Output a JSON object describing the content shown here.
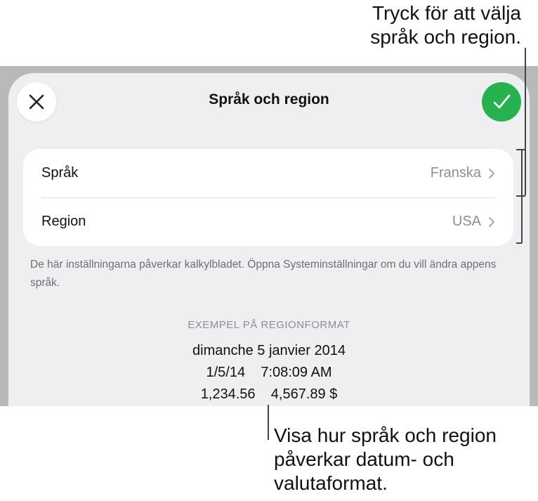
{
  "callouts": {
    "top_line1": "Tryck för att välja",
    "top_line2": "språk och region.",
    "bottom_line1": "Visa hur språk och region",
    "bottom_line2": "påverkar datum- och",
    "bottom_line3": "valutaformat."
  },
  "dialog": {
    "title": "Språk och region",
    "close_icon": "close-icon",
    "confirm_icon": "checkmark-icon"
  },
  "settings": {
    "language_label": "Språk",
    "language_value": "Franska",
    "region_label": "Region",
    "region_value": "USA"
  },
  "note": "De här inställningarna påverkar kalkylbladet. Öppna Systeminställningar om du vill ändra appens språk.",
  "sample": {
    "header": "EXEMPEL PÅ REGIONFORMAT",
    "date": "dimanche 5 janvier 2014",
    "datetime": "1/5/14    7:08:09 AM",
    "numbers": "1,234.56    4,567.89 $"
  },
  "colors": {
    "confirm": "#27b14f",
    "sheet": "#efeff2",
    "backdrop": "#b9b9b9"
  }
}
